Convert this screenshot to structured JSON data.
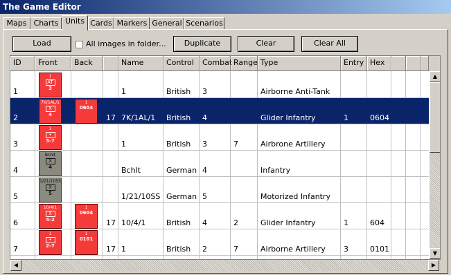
{
  "window": {
    "title": "The Game Editor"
  },
  "tabs": [
    "Maps",
    "Charts",
    "Units",
    "Cards",
    "Markers",
    "General",
    "Scenarios"
  ],
  "selected_tab": "Units",
  "toolbar": {
    "load_label": "Load",
    "all_images_label": "All images in folder...",
    "duplicate_label": "Duplicate",
    "clear_label": "Clear",
    "clear_all_label": "Clear All"
  },
  "columns": [
    "ID",
    "Front",
    "Back",
    "",
    "Name",
    "Control",
    "Combat",
    "Range",
    "Type",
    "Entry",
    "Hex"
  ],
  "rows": [
    {
      "id": "1",
      "front": {
        "color": "red",
        "top": "1",
        "sym": "AT",
        "val": "3"
      },
      "back": null,
      "extra": "",
      "name": "1",
      "control": "British",
      "combat": "3",
      "range": "",
      "type": "Airborne Anti-Tank",
      "entry": "",
      "hex": "",
      "selected": false
    },
    {
      "id": "2",
      "front": {
        "color": "red",
        "top": "7K/1AL/1",
        "sym": "X",
        "val": "4"
      },
      "back": {
        "color": "red",
        "top": "1",
        "sym": "",
        "val": "0604"
      },
      "extra": "17",
      "name": "7K/1AL/1",
      "control": "British",
      "combat": "4",
      "range": "",
      "type": "Glider Infantry",
      "entry": "1",
      "hex": "0604",
      "selected": true
    },
    {
      "id": "3",
      "front": {
        "color": "red",
        "top": "1",
        "sym": "•",
        "val": "3-7"
      },
      "back": null,
      "extra": "",
      "name": "1",
      "control": "British",
      "combat": "3",
      "range": "7",
      "type": "Airbrone Artillery",
      "entry": "",
      "hex": "",
      "selected": false
    },
    {
      "id": "4",
      "front": {
        "color": "gray",
        "top": "Bchlt",
        "sym": "X",
        "val": "4"
      },
      "back": null,
      "extra": "",
      "name": "Bchlt",
      "control": "German",
      "combat": "4",
      "range": "",
      "type": "Infantry",
      "entry": "",
      "hex": "",
      "selected": false
    },
    {
      "id": "5",
      "front": {
        "color": "gray",
        "top": "1/21/10SS",
        "sym": "X",
        "val": "5"
      },
      "back": null,
      "extra": "",
      "name": "1/21/10SS",
      "control": "German",
      "combat": "5",
      "range": "",
      "type": "Motorized Infantry",
      "entry": "",
      "hex": "",
      "selected": false
    },
    {
      "id": "6",
      "front": {
        "color": "red",
        "top": "10/4/1",
        "sym": "X",
        "val": "4-2"
      },
      "back": {
        "color": "red",
        "top": "1",
        "sym": "",
        "val": "0604"
      },
      "extra": "17",
      "name": "10/4/1",
      "control": "British",
      "combat": "4",
      "range": "2",
      "type": "Glider Infantry",
      "entry": "1",
      "hex": "604",
      "selected": false
    },
    {
      "id": "7",
      "front": {
        "color": "red",
        "top": "1",
        "sym": "•",
        "val": "2-7"
      },
      "back": {
        "color": "red",
        "top": "1",
        "sym": "",
        "val": "0101"
      },
      "extra": "17",
      "name": "1",
      "control": "British",
      "combat": "2",
      "range": "7",
      "type": "Airborne Artillery",
      "entry": "3",
      "hex": "0101",
      "selected": false
    }
  ]
}
